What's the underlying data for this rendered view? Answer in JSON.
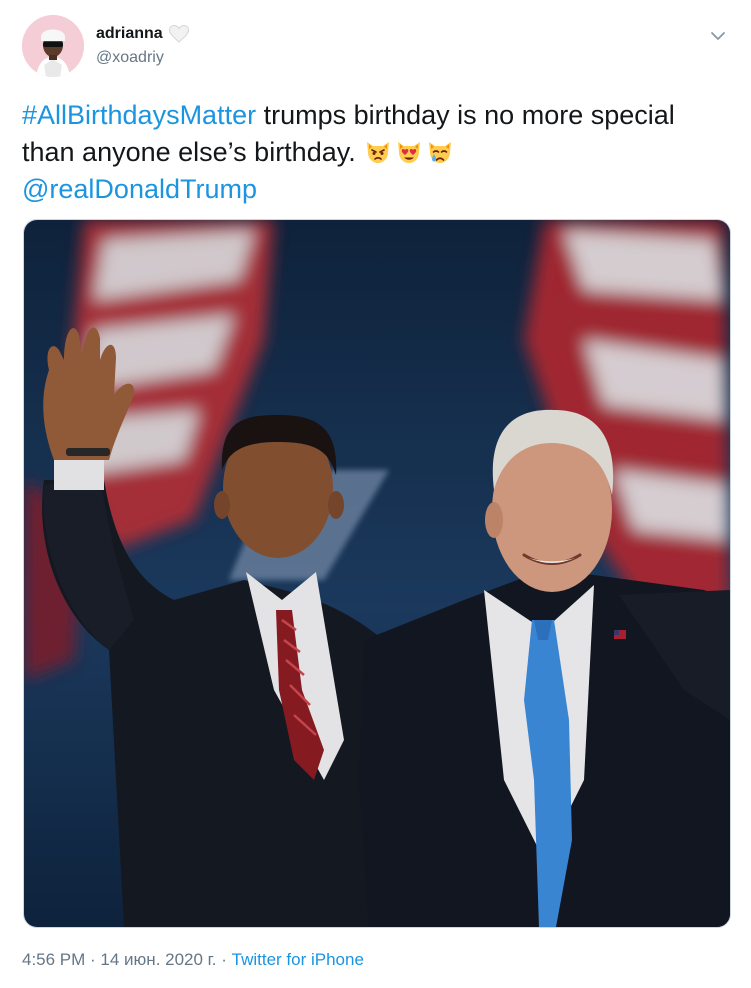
{
  "user": {
    "display_name": "adrianna",
    "handle": "@xoadriy"
  },
  "tweet": {
    "hashtag": "#AllBirthdaysMatter",
    "text_main": " trumps birthday is no more special than anyone else’s birthday. ",
    "emojis": [
      "pouting-cat-icon",
      "heart-eyes-cat-icon",
      "crying-cat-icon"
    ],
    "mention": "@realDonaldTrump"
  },
  "footer": {
    "time": "4:56 PM",
    "sep1": " · ",
    "date": "14 июн. 2020 г.",
    "sep2": " · ",
    "source": "Twitter for iPhone"
  },
  "colors": {
    "link": "#1b95e0",
    "muted": "#657786",
    "text": "#14171a"
  }
}
